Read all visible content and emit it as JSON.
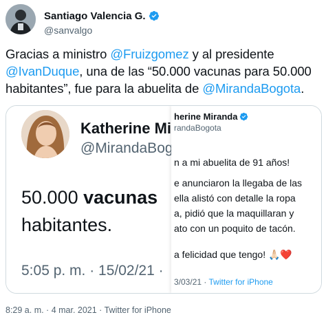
{
  "author": {
    "name": "Santiago Valencia G.",
    "handle": "@sanvalgo"
  },
  "tweet": {
    "segments": [
      {
        "text": "Gracias a ministro ",
        "mention": false
      },
      {
        "text": "@Fruizgomez",
        "mention": true
      },
      {
        "text": " y al presidente ",
        "mention": false
      },
      {
        "text": "@IvanDuque",
        "mention": true
      },
      {
        "text": ", una de las “50.000 vacunas para 50.000 habitantes”, fue para la abuelita de ",
        "mention": false
      },
      {
        "text": "@MirandaBogota",
        "mention": true
      },
      {
        "text": ".",
        "mention": false
      }
    ]
  },
  "quoted_image_left": {
    "name": "Katherine Mir",
    "handle": "@MirandaBogo",
    "big_prefix": "50.000 ",
    "big_bold": "vacunas",
    "big_line2": "habitantes.",
    "time": "5:05 p. m. · 15/02/21 ·"
  },
  "quoted_image_right": {
    "name": "herine Miranda",
    "handle": "randaBogota",
    "lines": [
      "n a mi abuelita de 91 años!",
      "e anunciaron la llegaba de las",
      "ella alistó con detalle la ropa",
      "a, pidió que la maquillaran y",
      "ato con un poquito de tacón.",
      "a felicidad que tengo! 🙏🏻❤️"
    ],
    "footer_date": "3/03/21 · ",
    "footer_source": "Twitter for iPhone"
  },
  "meta": {
    "timestamp": "8:29 a. m. · 4 mar. 2021 · Twitter for iPhone"
  },
  "colors": {
    "accent": "#1d9bf0",
    "text": "#0f1419",
    "muted": "#536471",
    "border": "#cfd9de"
  }
}
